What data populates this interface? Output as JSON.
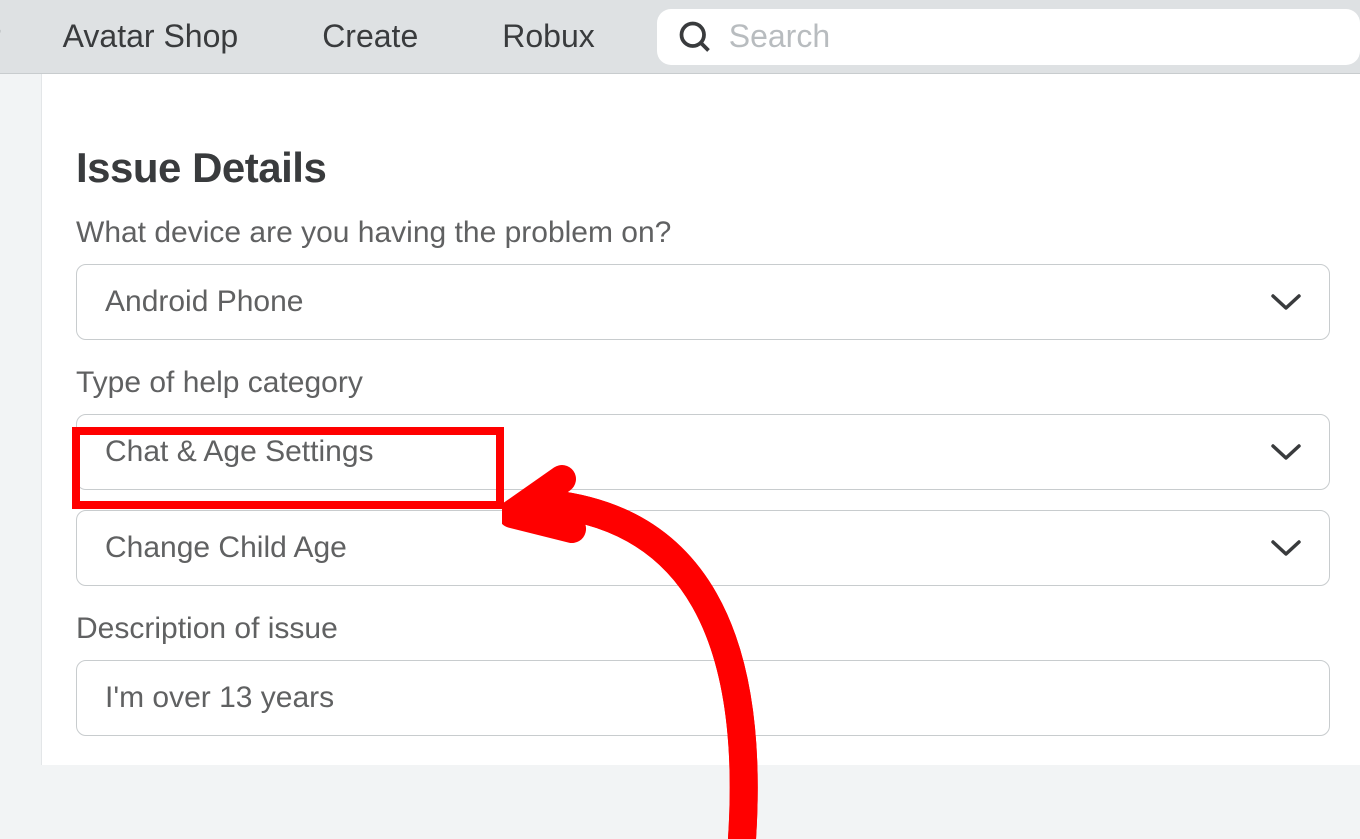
{
  "nav": {
    "partial_left": "r",
    "items": [
      "Avatar Shop",
      "Create",
      "Robux"
    ]
  },
  "search": {
    "placeholder": "Search"
  },
  "form": {
    "section_title": "Issue Details",
    "device_label": "What device are you having the problem on?",
    "device_value": "Android Phone",
    "category_label": "Type of help category",
    "category_value": "Chat & Age Settings",
    "subcategory_value": "Change Child Age",
    "description_label": "Description of issue",
    "description_value": "I'm over 13 years"
  },
  "colors": {
    "highlight": "#ff0000",
    "topnav_bg": "#dee1e3",
    "text_dark": "#393b3d",
    "text_muted": "#606162",
    "border": "#c8ccce"
  }
}
